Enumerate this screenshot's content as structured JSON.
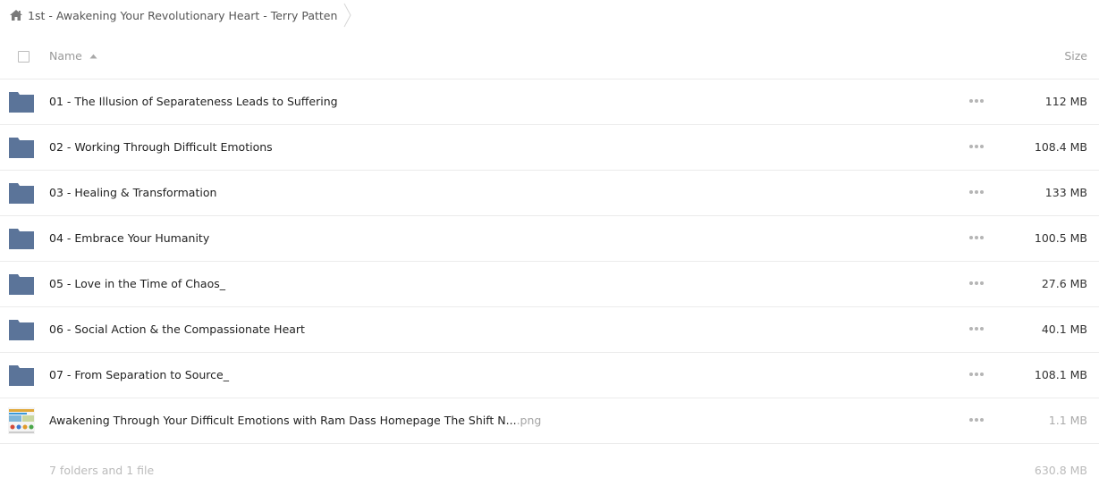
{
  "breadcrumb": {
    "items": [
      {
        "label": "1st - Awakening Your Revolutionary Heart - Terry Patten",
        "icon": "home-icon"
      }
    ]
  },
  "header": {
    "name_label": "Name",
    "size_label": "Size",
    "sort": "ascending"
  },
  "rows": [
    {
      "type": "folder",
      "name": "01 - The Illusion of Separateness Leads to Suffering",
      "size": "112 MB"
    },
    {
      "type": "folder",
      "name": "02 - Working Through Difficult Emotions",
      "size": "108.4 MB"
    },
    {
      "type": "folder",
      "name": "03 - Healing & Transformation",
      "size": "133 MB"
    },
    {
      "type": "folder",
      "name": "04 - Embrace Your Humanity",
      "size": "100.5 MB"
    },
    {
      "type": "folder",
      "name": "05 - Love in the Time of Chaos_",
      "size": "27.6 MB"
    },
    {
      "type": "folder",
      "name": "06 - Social Action & the Compassionate Heart",
      "size": "40.1 MB"
    },
    {
      "type": "folder",
      "name": "07 - From Separation to Source_",
      "size": "108.1 MB"
    },
    {
      "type": "file",
      "name": "Awakening Through Your Difficult Emotions with Ram Dass Homepage The Shift N...",
      "ext": ".png",
      "size": "1.1 MB"
    }
  ],
  "footer": {
    "summary": "7 folders and 1 file",
    "total": "630.8 MB"
  },
  "colors": {
    "folder": "#5b7499",
    "divider": "#ebebeb",
    "muted_text": "#9a9a9a",
    "text": "#222222"
  }
}
